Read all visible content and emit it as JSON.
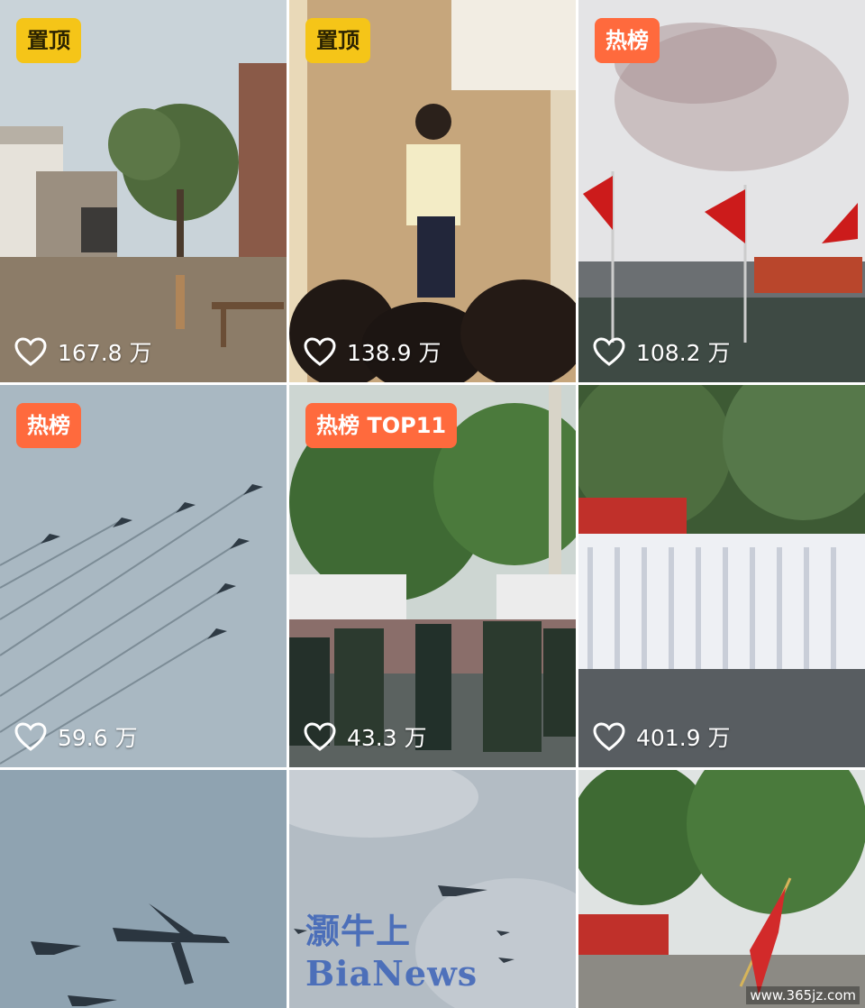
{
  "tiles": [
    {
      "badge": "置顶",
      "likes": "167.8 万"
    },
    {
      "badge": "置顶",
      "likes": "138.9 万"
    },
    {
      "badge": "热榜",
      "likes": "108.2 万"
    },
    {
      "badge": "热榜",
      "likes": "59.6 万"
    },
    {
      "badge": "热榜 TOP11",
      "likes": "43.3 万"
    },
    {
      "likes": "401.9 万"
    },
    {},
    {
      "watermark": "灏牛上 BiaNews"
    },
    {}
  ],
  "site_watermark": "www.365jz.com",
  "colors": {
    "pin_badge": "#f5c518",
    "hot_badge": "#ff6a3d"
  }
}
